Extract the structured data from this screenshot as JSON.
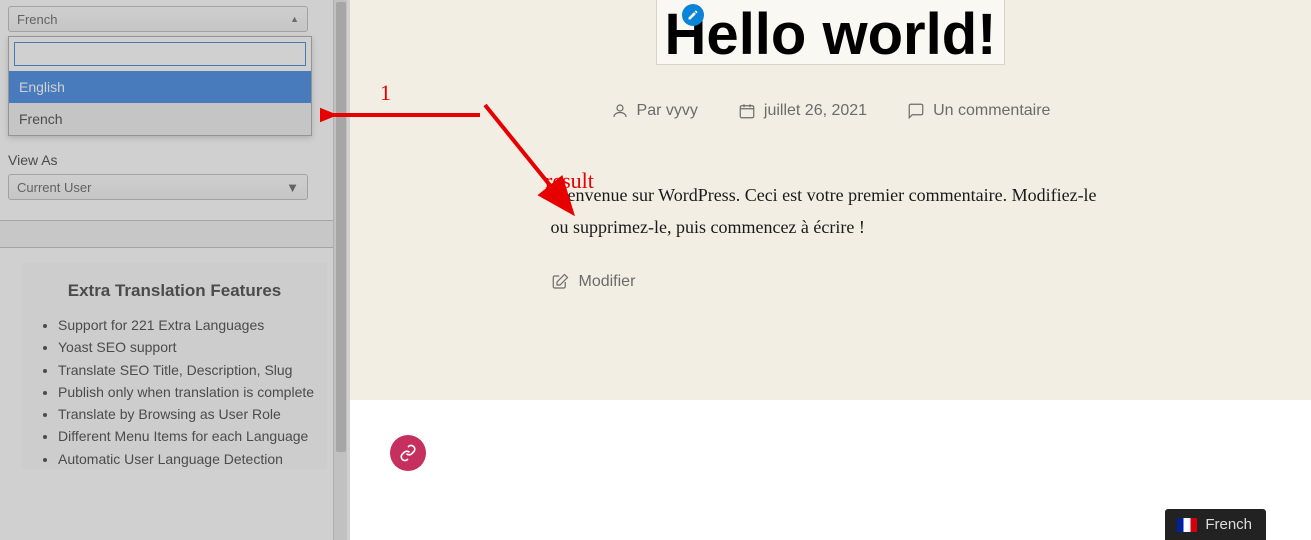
{
  "sidebar": {
    "lang_select_current": "French",
    "dropdown_options": [
      {
        "label": "English",
        "active": true
      },
      {
        "label": "French",
        "active": false
      }
    ],
    "dropdown_search_value": "",
    "view_as_label": "View As",
    "view_as_value": "Current User",
    "features": {
      "heading": "Extra Translation Features",
      "items": [
        "Support for 221 Extra Languages",
        "Yoast SEO support",
        "Translate SEO Title, Description, Slug",
        "Publish only when translation is complete",
        "Translate by Browsing as User Role",
        "Different Menu Items for each Language",
        "Automatic User Language Detection"
      ]
    }
  },
  "post": {
    "title": "Hello world!",
    "author_prefix": "Par",
    "author": "vyvy",
    "date": "juillet 26, 2021",
    "comments": "Un commentaire",
    "body": "Bienvenue sur WordPress. Ceci est votre premier commentaire. Modifiez-le ou supprimez-le, puis commencez à écrire !",
    "edit_link": "Modifier"
  },
  "language_switcher": {
    "label": "French"
  },
  "annotations": {
    "step1": "1",
    "result": "result"
  }
}
